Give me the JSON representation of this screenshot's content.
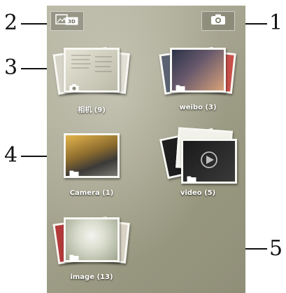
{
  "toolbar": {
    "mode_button_icon": "photo-3d-toggle-icon",
    "mode_button_text": "3D",
    "camera_button_icon": "camera-icon"
  },
  "albums": [
    {
      "label": "相机 (9)",
      "type_icon": "camera-icon"
    },
    {
      "label": "weibo (3)",
      "type_icon": "folder-icon"
    },
    {
      "label": "Camera (1)",
      "type_icon": "folder-icon"
    },
    {
      "label": "video (5)",
      "type_icon": "folder-icon"
    },
    {
      "label": "image (13)",
      "type_icon": "folder-icon"
    }
  ],
  "callouts": {
    "c1": "1",
    "c2": "2",
    "c3": "3",
    "c4": "4",
    "c5": "5"
  },
  "colors": {
    "frame": "#f7f7f2",
    "label_text": "#ffffff",
    "callout": "#111111"
  }
}
